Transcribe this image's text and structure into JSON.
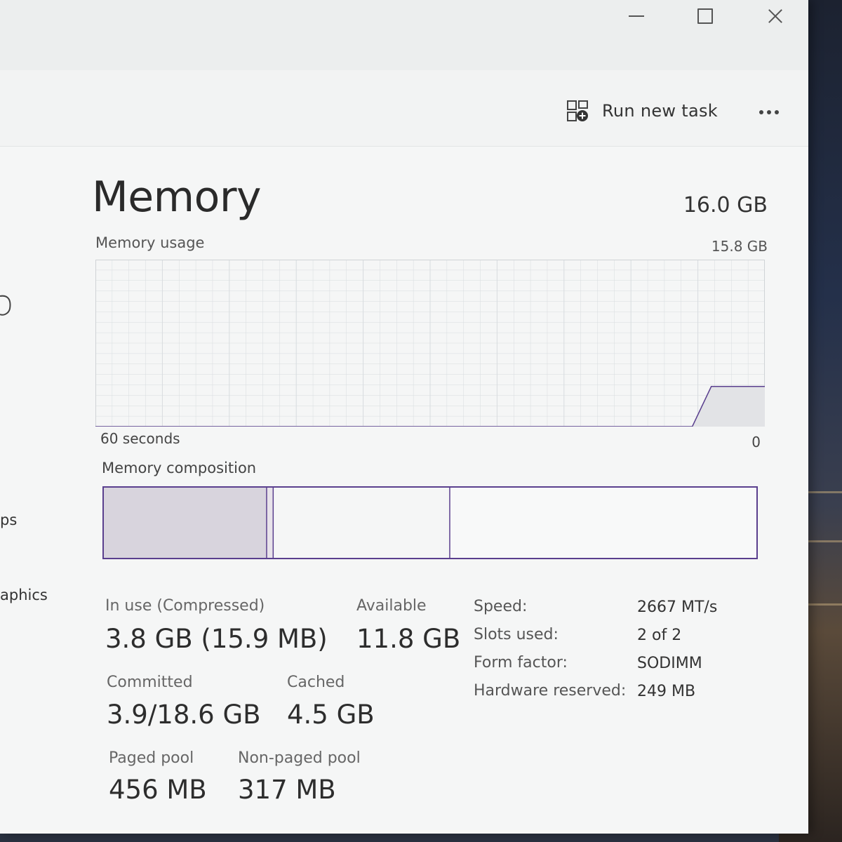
{
  "window_controls": {
    "minimize": "minimize",
    "maximize": "maximize",
    "close": "close"
  },
  "command_bar": {
    "run_new_task": "Run new task",
    "more_icon": "more-horizontal-icon"
  },
  "sidebar_fragments": [
    "ps",
    "aphics"
  ],
  "memory": {
    "title": "Memory",
    "total": "16.0 GB",
    "usage_label": "Memory usage",
    "usage_max": "15.8 GB",
    "graph_left_label": "60 seconds",
    "graph_right_label": "0",
    "composition_label": "Memory composition",
    "composition": {
      "in_use_fraction": 0.25,
      "modified_fraction": 0.01,
      "standby_fraction": 0.27,
      "free_fraction": 0.47
    },
    "usage_history": {
      "times_s": [
        60,
        6.5,
        4.8,
        0
      ],
      "used_gb": [
        0,
        0,
        3.8,
        3.8
      ]
    }
  },
  "stats": [
    {
      "label": "In use (Compressed)",
      "value": "3.8 GB (15.9 MB)"
    },
    {
      "label": "Available",
      "value": "11.8 GB"
    },
    {
      "label": "Committed",
      "value": "3.9/18.6 GB"
    },
    {
      "label": "Cached",
      "value": "4.5 GB"
    },
    {
      "label": "Paged pool",
      "value": "456 MB"
    },
    {
      "label": "Non-paged pool",
      "value": "317 MB"
    }
  ],
  "specs": [
    {
      "label": "Speed:",
      "value": "2667 MT/s"
    },
    {
      "label": "Slots used:",
      "value": "2 of 2"
    },
    {
      "label": "Form factor:",
      "value": "SODIMM"
    },
    {
      "label": "Hardware reserved:",
      "value": "249 MB"
    }
  ],
  "colors": {
    "accent": "#5a3f8e",
    "graph_fill": "#e2e3e6",
    "grid": "#d8dcdf"
  }
}
